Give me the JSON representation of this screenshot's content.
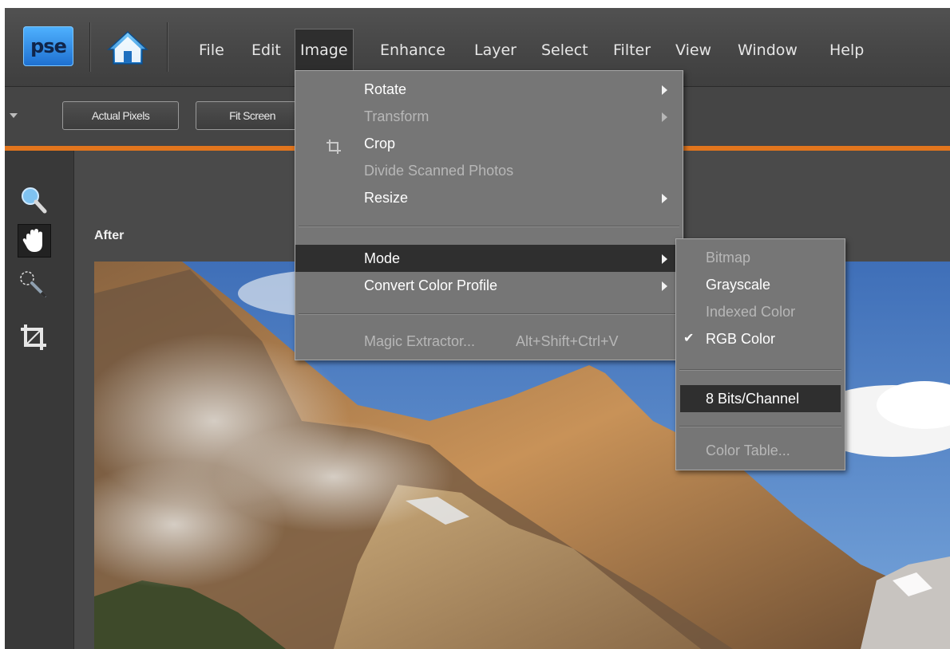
{
  "app": {
    "logo_text": "pse",
    "home_icon": "home-icon"
  },
  "menubar": {
    "items": [
      "File",
      "Edit",
      "Image",
      "Enhance",
      "Layer",
      "Select",
      "Filter",
      "View",
      "Window",
      "Help"
    ],
    "active": "Image"
  },
  "toolbar": {
    "actual_pixels": "Actual Pixels",
    "fit_screen": "Fit Screen"
  },
  "tools": [
    "zoom-icon",
    "hand-icon",
    "quick-selection-icon",
    "crop-icon"
  ],
  "canvas": {
    "view_label": "After"
  },
  "image_menu": {
    "rotate": "Rotate",
    "transform": "Transform",
    "crop": "Crop",
    "divide": "Divide Scanned Photos",
    "resize": "Resize",
    "mode": "Mode",
    "convert": "Convert Color Profile",
    "magic": "Magic Extractor...",
    "magic_shortcut": "Alt+Shift+Ctrl+V"
  },
  "mode_submenu": {
    "bitmap": "Bitmap",
    "grayscale": "Grayscale",
    "indexed": "Indexed Color",
    "rgb": "RGB Color",
    "rgb_checked": true,
    "bits": "8 Bits/Channel",
    "color_table": "Color Table..."
  },
  "colors": {
    "accent": "#e2751d",
    "menu_bg": "#767676",
    "highlight": "#2f2f2f"
  }
}
